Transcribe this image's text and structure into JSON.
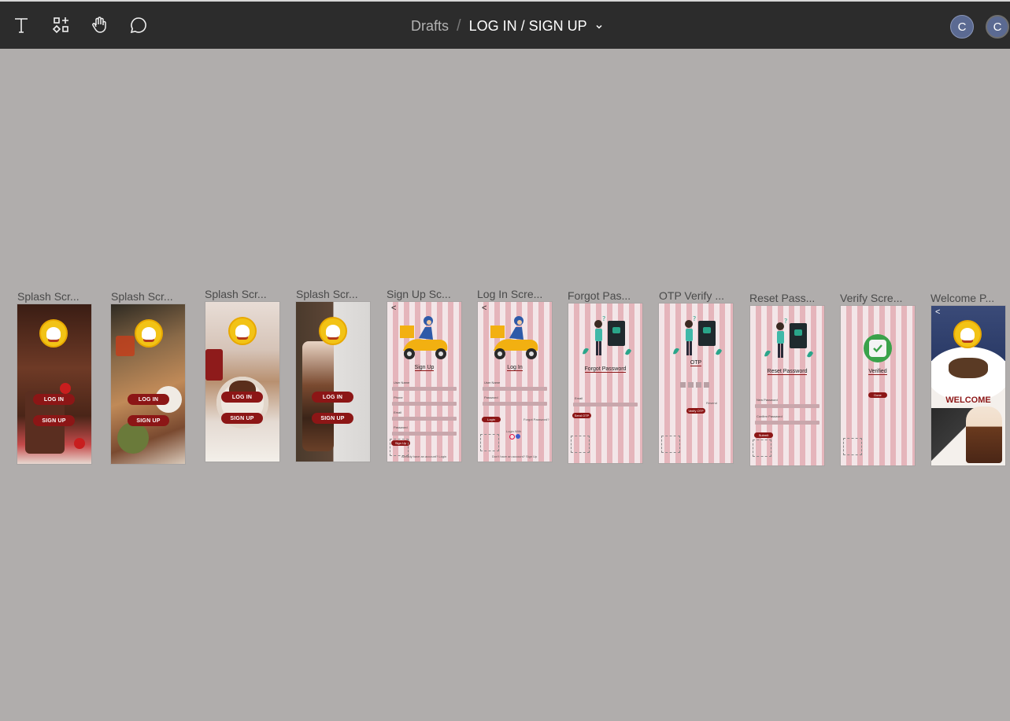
{
  "toolbar": {
    "tools": [
      {
        "name": "text-tool",
        "icon": "text-icon"
      },
      {
        "name": "components-tool",
        "icon": "components-icon"
      },
      {
        "name": "hand-tool",
        "icon": "hand-icon"
      },
      {
        "name": "comment-tool",
        "icon": "comment-icon"
      }
    ]
  },
  "breadcrumb": {
    "parent": "Drafts",
    "separator": "/",
    "file": "LOG IN / SIGN UP"
  },
  "avatars": [
    "C",
    "C"
  ],
  "frames": [
    {
      "label": "Splash Scr...",
      "buttons": [
        "LOG IN",
        "SIGN UP"
      ]
    },
    {
      "label": "Splash Scr...",
      "buttons": [
        "LOG IN",
        "SIGN UP"
      ]
    },
    {
      "label": "Splash Scr...",
      "buttons": [
        "LOG IN",
        "SIGN UP"
      ]
    },
    {
      "label": "Splash Scr...",
      "buttons": [
        "LOG IN",
        "SIGN UP"
      ]
    },
    {
      "label": "Sign Up Sc...",
      "title": "Sign Up",
      "fields": [
        "User Name",
        "Phone",
        "Email",
        "Password"
      ],
      "button": "Sign Up",
      "footer": "Already have an account? Login"
    },
    {
      "label": "Log In Scre...",
      "title": "Log In",
      "fields": [
        "User Name",
        "Password"
      ],
      "button": "Login",
      "link": "Forgot Password?",
      "social": "Login With",
      "footer": "Don't have an account? Sign Up"
    },
    {
      "label": "Forgot Pas...",
      "title": "Forgot Password",
      "fields": [
        "Email"
      ],
      "button": "Send OTP"
    },
    {
      "label": "OTP Verify ...",
      "title": "OTP",
      "button": "Verify OTP",
      "link": "Resend"
    },
    {
      "label": "Reset Pass...",
      "title": "Reset Password",
      "fields": [
        "New Password",
        "Confirm Password"
      ],
      "button": "Submit"
    },
    {
      "label": "Verify Scre...",
      "title": "Verified",
      "button": "Done"
    },
    {
      "label": "Welcome P...",
      "title": "WELCOME"
    }
  ],
  "colors": {
    "canvas": "#b0adac",
    "topbar": "#2c2c2c",
    "accent": "#8c1616",
    "avatar": "#5b6a92"
  }
}
